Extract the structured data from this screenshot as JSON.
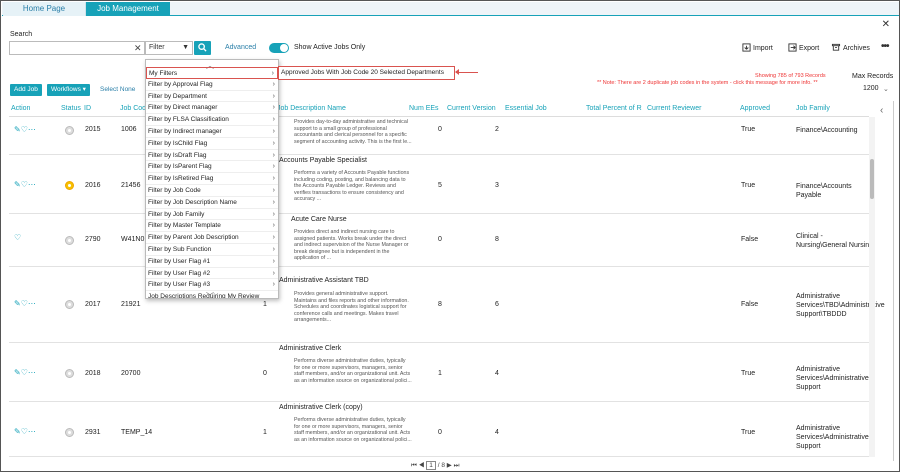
{
  "tabs": {
    "home": "Home Page",
    "job_management": "Job Management"
  },
  "search": {
    "label": "Search",
    "placeholder": "",
    "filter_value": "Filter",
    "advanced": "Advanced",
    "show_active": "Show Active Jobs Only"
  },
  "toolbar": {
    "import": "Import",
    "export": "Export",
    "archives": "Archives"
  },
  "actions": {
    "add_job": "Add Job",
    "workflows": "Workflows",
    "select_none": "Select None"
  },
  "messages": {
    "note": "** Note: There are 2 duplicate job codes in the system - click this message for more info. **",
    "showing": "Showing 785 of 793 Records",
    "max_records_label": "Max Records",
    "max_records_value": "1200"
  },
  "table": {
    "headers": {
      "action": "Action",
      "status": "Status",
      "id": "ID",
      "job_code": "Job Code",
      "desc": "Job Description Name",
      "num_ees": "Num EEs",
      "current_version": "Current Version",
      "essential_job": "Essential Job",
      "total_percent": "Total Percent of R",
      "current_reviewer": "Current Reviewer",
      "approved": "Approved",
      "job_family": "Job Family"
    },
    "rows": [
      {
        "id": "2015",
        "code": "1006",
        "title": "",
        "desc": "Provides day-to-day administrative and technical support to a small group of professional accountants and clerical personnel for a specific segment of accounting activity.  This is the first le...",
        "ees": "0",
        "version": "2",
        "approved": "True",
        "family": "Finance\\Accounting"
      },
      {
        "id": "2016",
        "code": "21456",
        "title": "Accounts Payable Specialist",
        "desc": "Performs a variety of Accounts Payable functions including coding, posting, and balancing data to the Accounts Payable Ledger.  Reviews and verifies transactions to ensure consistency and accuracy ...",
        "ees": "5",
        "version": "3",
        "approved": "True",
        "family": "Finance\\Accounts Payable"
      },
      {
        "id": "2790",
        "code": "W41N0",
        "title": "Acute Care Nurse",
        "desc": "Provides direct and indirect nursing care to assigned patients. Works break under the direct and indirect supervision of the Nurse Manager or break designee but is independent in the application of ...",
        "ees": "0",
        "version": "8",
        "approved": "False",
        "family": "Clinical - Nursing\\General Nursing"
      },
      {
        "id": "2017",
        "code": "21921",
        "title": "Administrative Assistant TBD",
        "desc": "Provides general administrative support. Maintains and files reports and other information. Schedules and coordinates logistical support for conference calls and meetings. Makes travel arrangements...",
        "ees": "8",
        "version": "6",
        "approved": "False",
        "family": "Administrative Services\\TBD\\Administrative Support\\TBDDD"
      },
      {
        "id": "2018",
        "code": "20700",
        "title": "Administrative Clerk",
        "desc": "Performs diverse administrative duties, typically for one or more supervisors, managers, senior staff members, and/or an organizational unit.  Acts as an information source on organizational polici...",
        "ees": "1",
        "version": "4",
        "approved": "True",
        "family": "Administrative Services\\Administrative Support"
      },
      {
        "id": "2931",
        "code": "TEMP_14",
        "title": "Administrative Clerk (copy)",
        "desc": "Performs diverse administrative duties, typically for one or more supervisors, managers, senior staff members, and/or an organizational unit.  Acts as an information source on organizational polici...",
        "ees": "0",
        "version": "4",
        "approved": "True",
        "family": "Administrative Services\\Administrative Support"
      }
    ],
    "partial_code_nums": [
      "1",
      "1",
      "0",
      "1"
    ]
  },
  "dropdown": {
    "items": [
      "My Filters",
      "Filter by Approval Flag",
      "Filter by Department",
      "Filter by Direct manager",
      "Filter by FLSA Classification",
      "Filter by Indirect manager",
      "Filter by IsChild Flag",
      "Filter by IsDraft Flag",
      "Filter by IsParent Flag",
      "Filter by IsRetired Flag",
      "Filter by Job Code",
      "Filter by Job Description Name",
      "Filter by Job Family",
      "Filter by Master Template",
      "Filter by Parent Job Description",
      "Filter by Sub Function",
      "Filter by User Flag #1",
      "Filter by User Flag #2",
      "Filter by User Flag #3",
      "Job Descriptions Requiring My Review"
    ],
    "submenu": "Approved Jobs With Job Code 20 Selected Departments"
  },
  "pager": {
    "current": "1",
    "total": "/ 8"
  },
  "colors": {
    "accent": "#17a2b8",
    "warning": "#e33",
    "highlight": "#d9534f"
  }
}
